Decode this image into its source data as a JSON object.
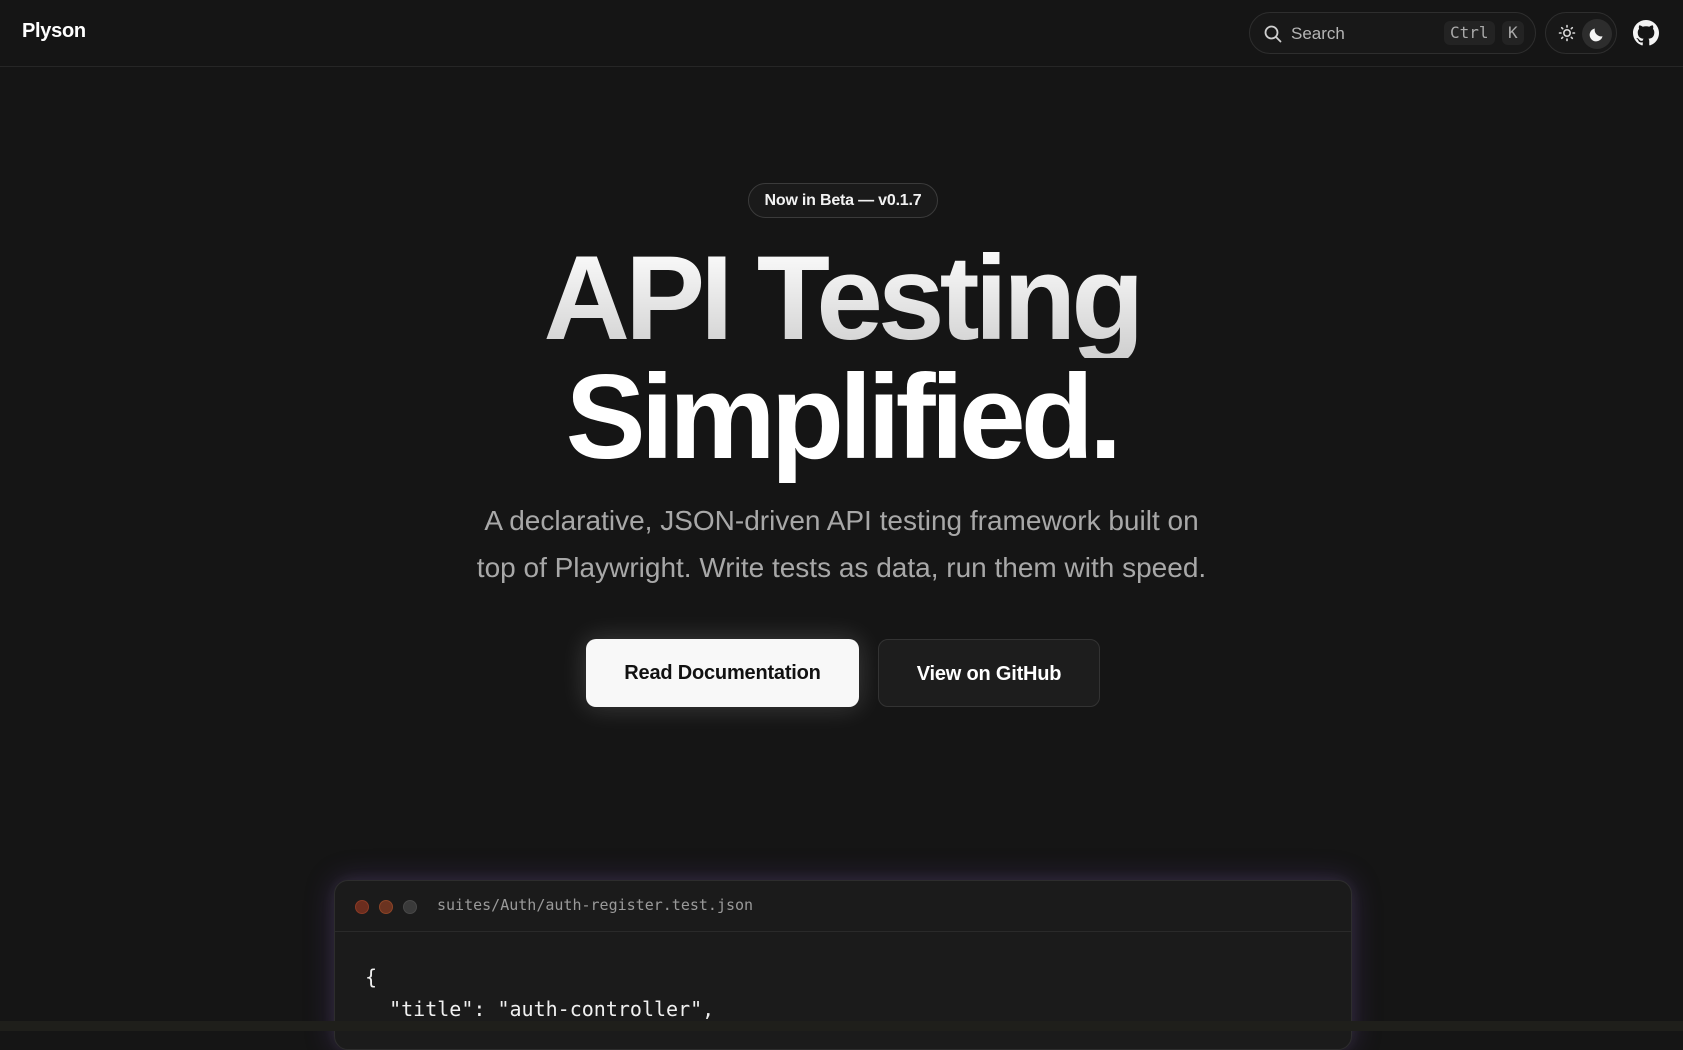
{
  "header": {
    "brand": "Plyson",
    "search": {
      "placeholder": "Search",
      "shortcut_ctrl": "Ctrl",
      "shortcut_key": "K"
    },
    "theme_toggle": {
      "options": [
        "light",
        "dark"
      ],
      "selected": "dark"
    },
    "github_icon": "github-icon"
  },
  "hero": {
    "badge": "Now in Beta — v0.1.7",
    "title_line1": "API Testing",
    "title_line2": "Simplified.",
    "subtitle_line1": "A declarative, JSON-driven API testing framework built on",
    "subtitle_line2": "top of Playwright. Write tests as data, run them with speed.",
    "primary_cta": "Read Documentation",
    "secondary_cta": "View on GitHub"
  },
  "code_preview": {
    "filename": "suites/Auth/auth-register.test.json",
    "lines": [
      "{",
      "  \"title\": \"auth-controller\","
    ]
  },
  "colors": {
    "background": "#151515",
    "primary_button": "#f8f8f8",
    "secondary_button": "#1d1d1d",
    "accent_glow": "#7846c8"
  }
}
